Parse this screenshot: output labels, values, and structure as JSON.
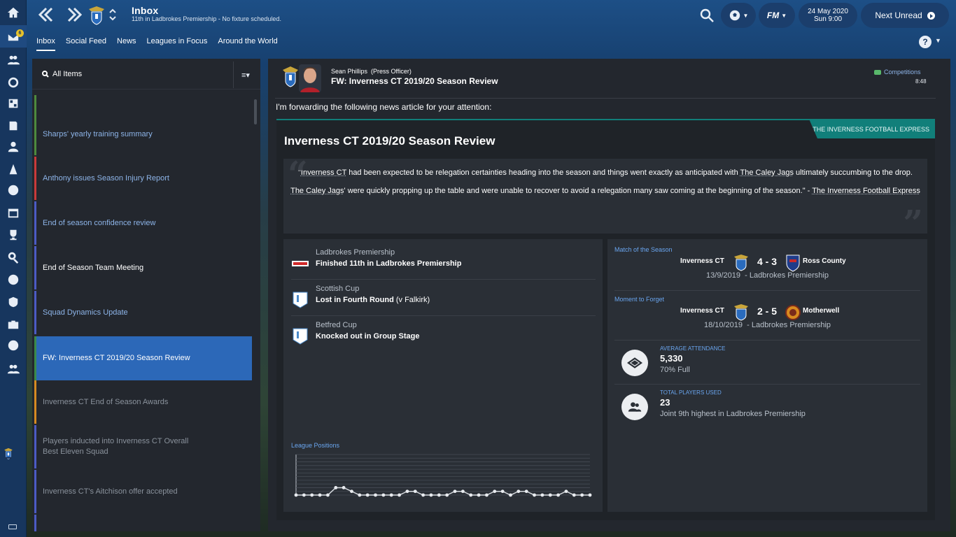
{
  "header": {
    "title": "Inbox",
    "subtitle": "11th in Ladbrokes Premiership - No fixture scheduled.",
    "date": "24 May 2020",
    "time": "Sun 9:00",
    "next_unread": "Next Unread",
    "fm_label": "FM"
  },
  "rail": {
    "badge": "6"
  },
  "tabs": [
    "Inbox",
    "Social Feed",
    "News",
    "Leagues in Focus",
    "Around the World"
  ],
  "list": {
    "filter": "All Items",
    "items": [
      {
        "label": "Sharps' yearly training summary",
        "color": "#8db4e8",
        "bar": "#4d8a3e"
      },
      {
        "label": "Anthony issues Season Injury Report",
        "color": "#8db4e8",
        "bar": "#c93a3a"
      },
      {
        "label": "End of season confidence review",
        "color": "#8db4e8",
        "bar": "#4b5bc4"
      },
      {
        "label": "End of Season Team Meeting",
        "color": "#ffffff",
        "bar": "#4b5bc4"
      },
      {
        "label": "Squad Dynamics Update",
        "color": "#8db4e8",
        "bar": "#4b5bc4"
      },
      {
        "label": "FW: Inverness CT 2019/20 Season Review",
        "color": "#ffffff",
        "bar": "#3a8a4a"
      },
      {
        "label": "Inverness CT End of Season Awards",
        "color": "#8a929c",
        "bar": "#d68a22"
      },
      {
        "label": "Players inducted into Inverness CT Overall Best Eleven Squad",
        "color": "#8a929c",
        "bar": "#4b5bc4"
      },
      {
        "label": "Inverness CT's Aitchison offer accepted",
        "color": "#8a929c",
        "bar": "#4b5bc4"
      }
    ]
  },
  "message": {
    "sender_name": "Sean Phillips",
    "sender_role": "(Press Officer)",
    "subject": "FW: Inverness CT 2019/20 Season Review",
    "category": "Competitions",
    "time": "8:48",
    "intro": "I'm forwarding the following news article for your attention:"
  },
  "article": {
    "paper": "THE INVERNESS FOOTBALL EXPRESS",
    "title": "Inverness CT 2019/20 Season Review",
    "q1": {
      "a": "\"",
      "b": "Inverness CT",
      "c": " had been expected to be relegation certainties heading into the season and things went exactly as anticipated with ",
      "d": "The Caley Jags",
      "e": " ultimately succumbing to the drop."
    },
    "q2": {
      "a": "The Caley Jags",
      "b": "' were quickly propping up the table and were unable to recover to avoid a relegation many saw coming at the beginning of the season.\" - ",
      "c": "The Inverness Football Express"
    }
  },
  "competitions": [
    {
      "name": "Ladbrokes Premiership",
      "result": "Finished 11th in Ladbrokes Premiership",
      "extra": ""
    },
    {
      "name": "Scottish Cup",
      "result": "Lost in Fourth Round",
      "extra": " (v Falkirk)"
    },
    {
      "name": "Betfred Cup",
      "result": "Knocked out in Group Stage",
      "extra": ""
    }
  ],
  "league_positions_label": "League Positions",
  "chart_data": {
    "type": "line",
    "title": "League Positions",
    "x": [
      1,
      2,
      3,
      4,
      5,
      6,
      7,
      8,
      9,
      10,
      11,
      12,
      13,
      14,
      15,
      16,
      17,
      18,
      19,
      20,
      21,
      22,
      23,
      24,
      25,
      26,
      27,
      28,
      29,
      30,
      31,
      32,
      33,
      34,
      35,
      36,
      37,
      38
    ],
    "series": [
      {
        "values": [
          12,
          12,
          12,
          12,
          12,
          10,
          10,
          11,
          12,
          12,
          12,
          12,
          12,
          12,
          11,
          11,
          12,
          12,
          12,
          12,
          11,
          11,
          12,
          12,
          12,
          11,
          11,
          12,
          11,
          11,
          12,
          12,
          12,
          12,
          11,
          12,
          12,
          12
        ]
      }
    ],
    "ylim": [
      1,
      12
    ],
    "grid": true
  },
  "match_of_season": {
    "label": "Match of the Season",
    "home": "Inverness CT",
    "score": "4 - 3",
    "away": "Ross County",
    "date": "13/9/2019",
    "sep": "-",
    "comp": "Ladbrokes Premiership"
  },
  "moment_to_forget": {
    "label": "Moment to Forget",
    "home": "Inverness CT",
    "score": "2 - 5",
    "away": "Motherwell",
    "date": "18/10/2019",
    "sep": "-",
    "comp": "Ladbrokes Premiership"
  },
  "attendance": {
    "label": "AVERAGE ATTENDANCE",
    "value": "5,330",
    "sub": "70% Full"
  },
  "players": {
    "label": "TOTAL PLAYERS USED",
    "value": "23",
    "sub": "Joint 9th highest in Ladbrokes Premiership"
  }
}
